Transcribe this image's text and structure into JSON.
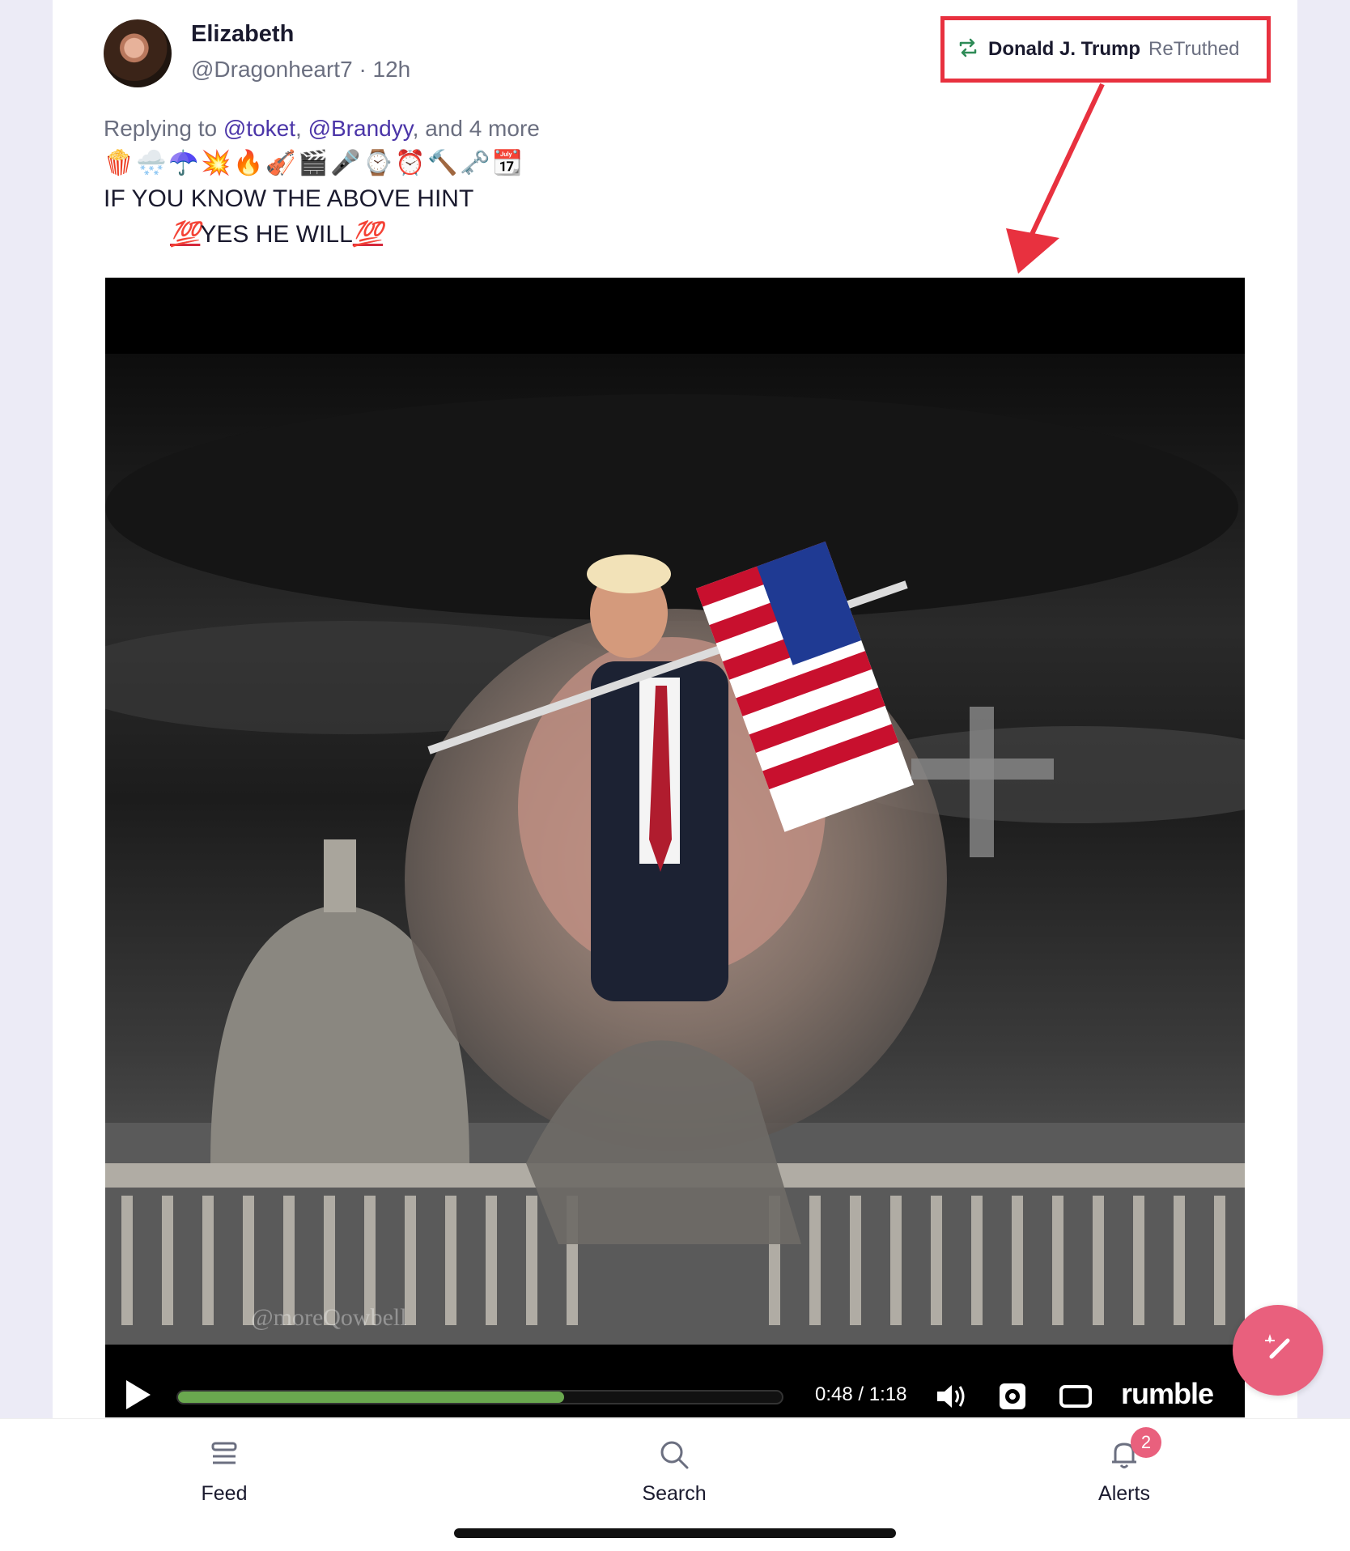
{
  "post": {
    "author_name": "Elizabeth",
    "handle": "@Dragonheart7",
    "time": "· 12h",
    "retruth": {
      "name": "Donald J. Trump",
      "label": "ReTruthed"
    },
    "replying_prefix": "Replying to",
    "mention1": "@toket",
    "mention2": "@Brandyy",
    "replying_suffix": ", and 4 more",
    "emojis": [
      "🍿",
      "🌨️",
      "☂️",
      "💥",
      "🔥",
      "🎻",
      "🎬",
      "🎤",
      "⌚",
      "⏰",
      "🔨",
      "🗝️",
      "📆"
    ],
    "text_line1": "IF YOU KNOW THE ABOVE HINT",
    "hundred": "💯",
    "text_line2": "YES HE WILL"
  },
  "video": {
    "watermark": "@moreQowbell",
    "time_display": "0:48 / 1:18",
    "progress_fraction": 0.64,
    "brand": "rumble"
  },
  "colors": {
    "highlight_box": "#e8313f",
    "progress": "#6aa84f",
    "fab": "#e9607d",
    "badge": "#e9607d"
  },
  "nav": {
    "feed": {
      "label": "Feed",
      "icon": "feed-icon"
    },
    "search": {
      "label": "Search",
      "icon": "search-icon"
    },
    "alerts": {
      "label": "Alerts",
      "icon": "bell-icon",
      "badge": "2"
    }
  },
  "fab": {
    "icon": "compose-icon"
  }
}
